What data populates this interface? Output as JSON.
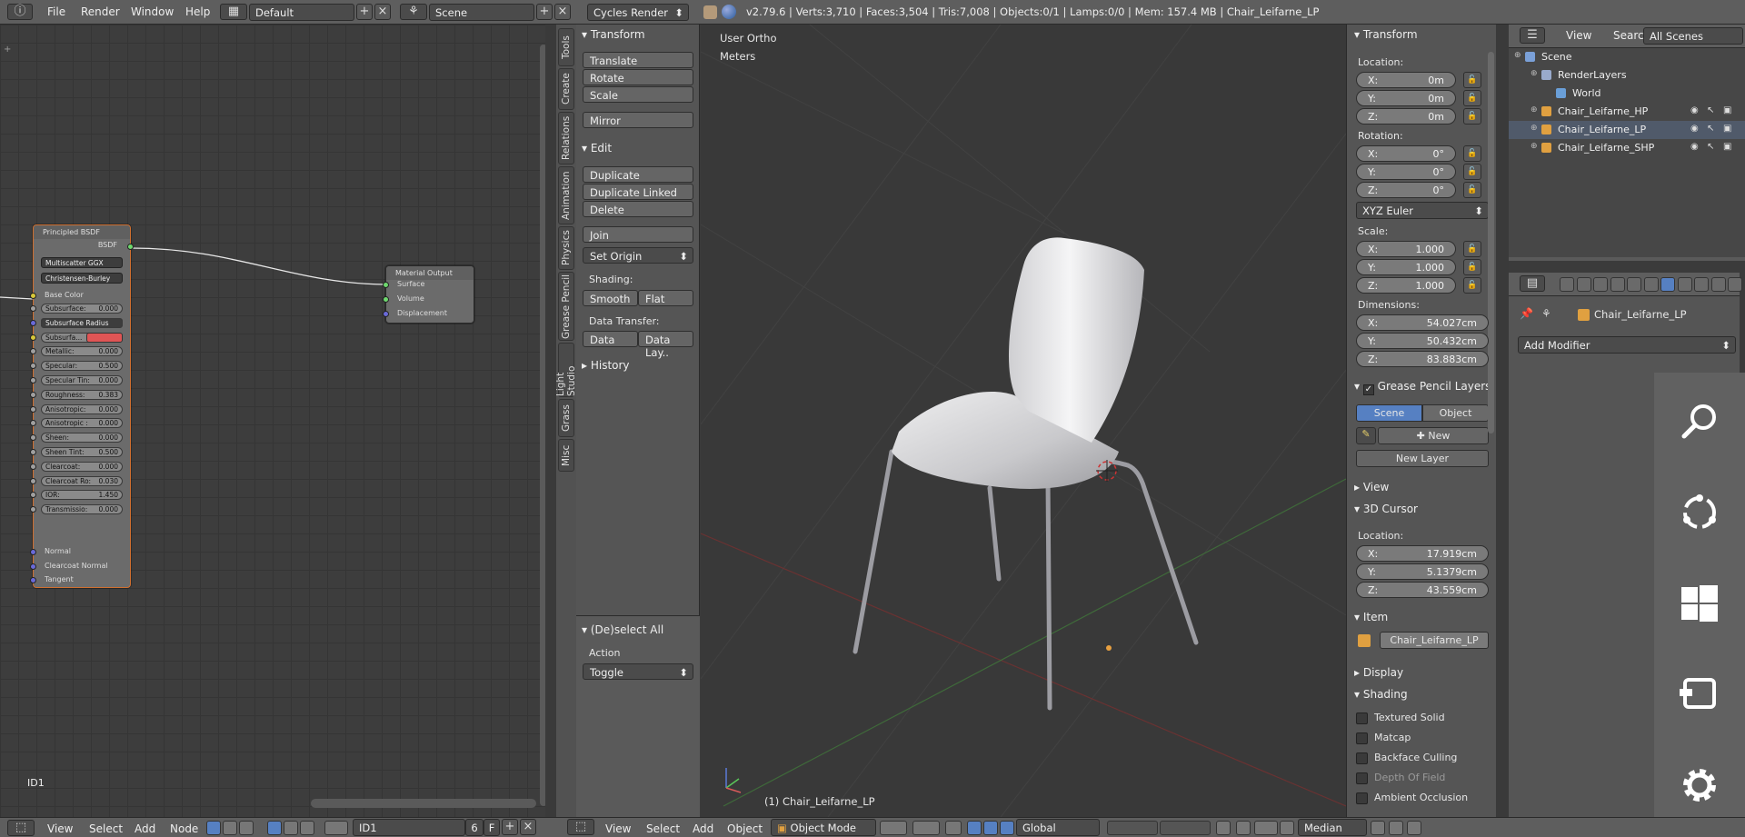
{
  "topbar": {
    "menus": [
      "File",
      "Render",
      "Window",
      "Help"
    ],
    "layout_name": "Default",
    "scene_name": "Scene",
    "render_engine": "Cycles Render",
    "stats": "v2.79.6 | Verts:3,710 | Faces:3,504 | Tris:7,008 | Objects:0/1 | Lamps:0/0 | Mem: 157.4 MB | Chair_Leifarne_LP"
  },
  "node_editor": {
    "principled": {
      "title": "Principled BSDF",
      "output": "BSDF",
      "distribution": "Multiscatter GGX",
      "subsurface_method": "Christensen-Burley",
      "base_color_label": "Base Color",
      "fields": [
        {
          "label": "Subsurface:",
          "value": "0.000"
        },
        {
          "label": "Subsurface Radius",
          "value": ""
        },
        {
          "label": "Subsurfa...",
          "value": ""
        },
        {
          "label": "Metallic:",
          "value": "0.000"
        },
        {
          "label": "Specular:",
          "value": "0.500"
        },
        {
          "label": "Specular Tin:",
          "value": "0.000"
        },
        {
          "label": "Roughness:",
          "value": "0.383"
        },
        {
          "label": "Anisotropic:",
          "value": "0.000"
        },
        {
          "label": "Anisotropic :",
          "value": "0.000"
        },
        {
          "label": "Sheen:",
          "value": "0.000"
        },
        {
          "label": "Sheen Tint:",
          "value": "0.500"
        },
        {
          "label": "Clearcoat:",
          "value": "0.000"
        },
        {
          "label": "Clearcoat Ro:",
          "value": "0.030"
        },
        {
          "label": "IOR:",
          "value": "1.450"
        },
        {
          "label": "Transmissio:",
          "value": "0.000"
        }
      ],
      "vector_inputs": [
        "Normal",
        "Clearcoat Normal",
        "Tangent"
      ],
      "subsurface_color": "#e05555"
    },
    "material_output": {
      "title": "Material Output",
      "inputs": [
        "Surface",
        "Volume",
        "Displacement"
      ]
    },
    "frame_label": "ID1"
  },
  "tool_tabs": [
    "Tools",
    "Create",
    "Relations",
    "Animation",
    "Physics",
    "Grease Pencil",
    "Light Studio",
    "Grass",
    "Misc"
  ],
  "tool_shelf": {
    "transform_header": "Transform",
    "transform_buttons": [
      "Translate",
      "Rotate",
      "Scale",
      "Mirror"
    ],
    "edit_header": "Edit",
    "edit_buttons": [
      "Duplicate",
      "Duplicate Linked",
      "Delete",
      "Join"
    ],
    "set_origin": "Set Origin",
    "shading_label": "Shading:",
    "smooth": "Smooth",
    "flat": "Flat",
    "data_transfer_label": "Data Transfer:",
    "data": "Data",
    "data_lay": "Data Lay..",
    "history_header": "History",
    "operator_header": "(De)select All",
    "action_label": "Action",
    "action_value": "Toggle"
  },
  "viewport": {
    "view_name": "User Ortho",
    "units": "Meters",
    "object_label": "(1) Chair_Leifarne_LP"
  },
  "properties": {
    "transform_header": "Transform",
    "location_label": "Location:",
    "location": [
      {
        "k": "X:",
        "v": "0m"
      },
      {
        "k": "Y:",
        "v": "0m"
      },
      {
        "k": "Z:",
        "v": "0m"
      }
    ],
    "rotation_label": "Rotation:",
    "rotation": [
      {
        "k": "X:",
        "v": "0°"
      },
      {
        "k": "Y:",
        "v": "0°"
      },
      {
        "k": "Z:",
        "v": "0°"
      }
    ],
    "rotation_mode": "XYZ Euler",
    "scale_label": "Scale:",
    "scale": [
      {
        "k": "X:",
        "v": "1.000"
      },
      {
        "k": "Y:",
        "v": "1.000"
      },
      {
        "k": "Z:",
        "v": "1.000"
      }
    ],
    "dimensions_label": "Dimensions:",
    "dimensions": [
      {
        "k": "X:",
        "v": "54.027cm"
      },
      {
        "k": "Y:",
        "v": "50.432cm"
      },
      {
        "k": "Z:",
        "v": "83.883cm"
      }
    ],
    "grease_header": "Grease Pencil Layers",
    "grease_scene": "Scene",
    "grease_object": "Object",
    "grease_new": "New",
    "new_layer": "New Layer",
    "view_header": "View",
    "cursor_header": "3D Cursor",
    "cursor_location_label": "Location:",
    "cursor": [
      {
        "k": "X:",
        "v": "17.919cm"
      },
      {
        "k": "Y:",
        "v": "5.1379cm"
      },
      {
        "k": "Z:",
        "v": "43.559cm"
      }
    ],
    "item_header": "Item",
    "item_name": "Chair_Leifarne_LP",
    "display_header": "Display",
    "shading_header": "Shading",
    "shading_options": [
      "Textured Solid",
      "Matcap",
      "Backface Culling",
      "Depth Of Field",
      "Ambient Occlusion"
    ]
  },
  "outliner": {
    "menus": [
      "View",
      "Search"
    ],
    "scope": "All Scenes",
    "items": [
      "Scene",
      "RenderLayers",
      "World",
      "Chair_Leifarne_HP",
      "Chair_Leifarne_LP",
      "Chair_Leifarne_SHP"
    ]
  },
  "modifiers": {
    "object_name": "Chair_Leifarne_LP",
    "add_modifier": "Add Modifier"
  },
  "bottombar": {
    "node_menus": [
      "View",
      "Select",
      "Add",
      "Node"
    ],
    "node_tree_name": "ID1",
    "users": "6",
    "fake": "F",
    "view3d_menus": [
      "View",
      "Select",
      "Add",
      "Object"
    ],
    "mode": "Object Mode",
    "orientation": "Global",
    "pivot": "Median"
  }
}
